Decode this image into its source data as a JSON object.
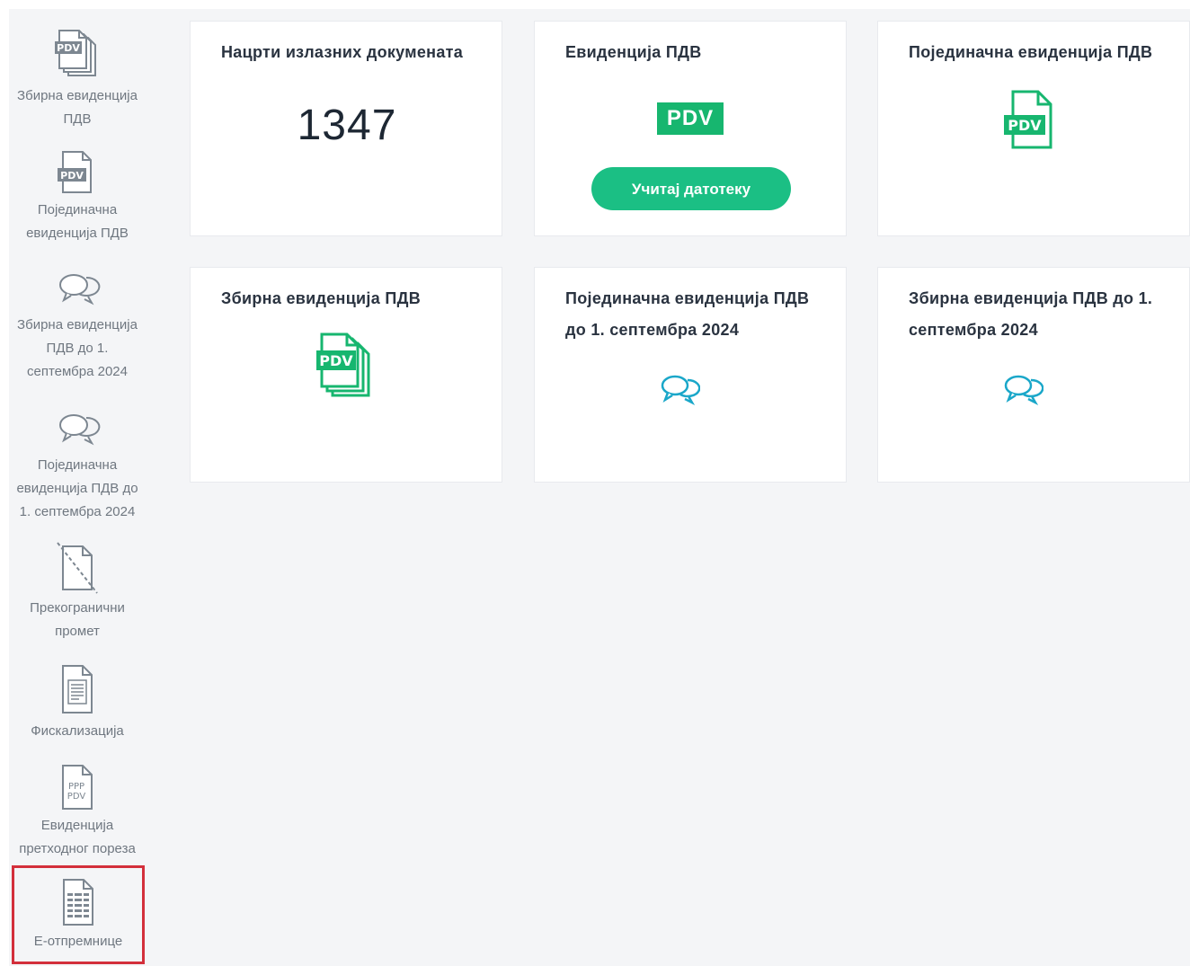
{
  "sidebar": {
    "items": [
      {
        "label": "Збирна евиденција\nПДВ",
        "icon": "pdv-stack-icon"
      },
      {
        "label": "Појединачна\nевиденција ПДВ",
        "icon": "pdv-file-icon"
      },
      {
        "label": "Збирна евиденција\nПДВ до 1.\nсептембра 2024",
        "icon": "chat-bubbles-icon"
      },
      {
        "label": "Појединачна\nевиденција ПДВ до\n1. септембра 2024",
        "icon": "chat-bubbles-icon"
      },
      {
        "label": "Прекогранични\nпромет",
        "icon": "crossed-document-icon"
      },
      {
        "label": "Фискализација",
        "icon": "receipt-document-icon"
      },
      {
        "label": "Евиденција\nпретходног пореза",
        "icon": "ppp-pdv-document-icon"
      },
      {
        "label": "Е-отпремнице",
        "icon": "table-document-icon"
      }
    ],
    "active_index": 7,
    "active_outline_color": "#d32f3b"
  },
  "cards": {
    "drafts": {
      "title": "Нацрти излазних докумената",
      "count": "1347"
    },
    "vat_records": {
      "title": "Евиденција ПДВ",
      "badge": "PDV",
      "button_label": "Учитај датотеку"
    },
    "single_vat": {
      "title": "Појединачна евиденција ПДВ",
      "badge": "PDV"
    },
    "collective_vat": {
      "title": "Збирна евиденција ПДВ",
      "badge": "PDV"
    },
    "single_vat_until": {
      "title": "Појединачна евиденција ПДВ до 1. септембра 2024"
    },
    "collective_vat_until": {
      "title": "Збирна евиденција ПДВ до 1. септембра 2024"
    }
  },
  "colors": {
    "accent_green": "#17b66f",
    "button_green": "#1bbf84",
    "chat_icon_teal": "#1aa7c9",
    "sidebar_bg": "#f4f5f7"
  }
}
